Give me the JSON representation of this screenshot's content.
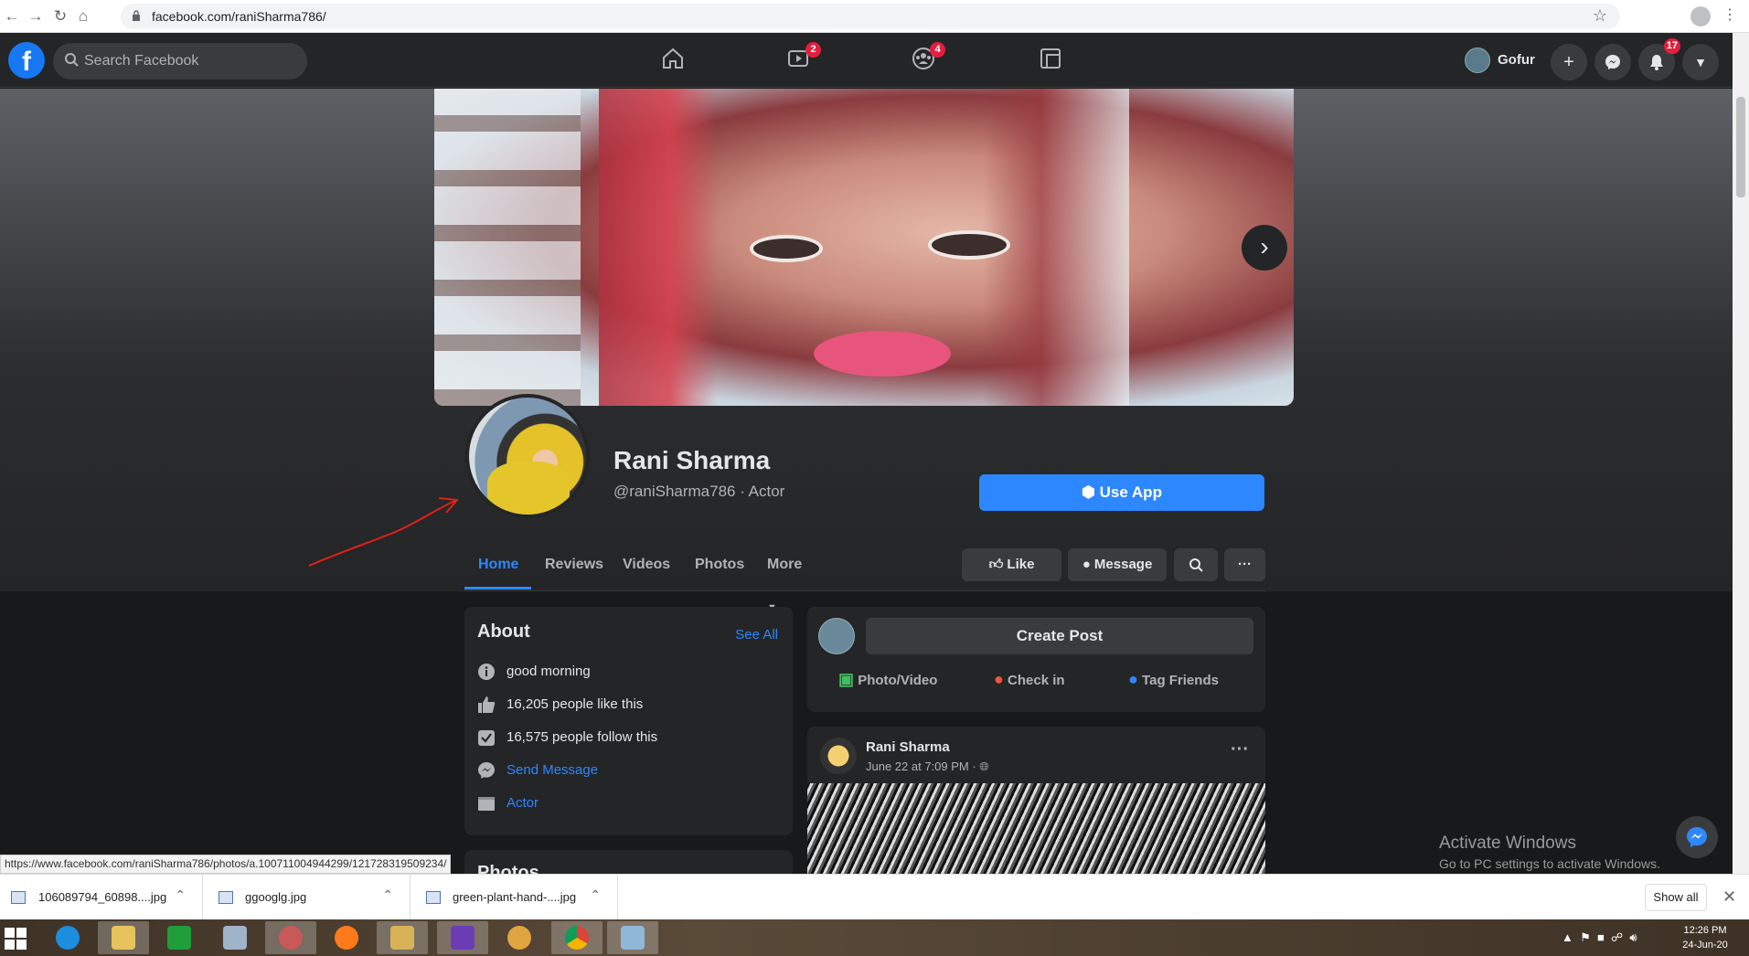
{
  "browser": {
    "url": "facebook.com/raniSharma786/",
    "status_url": "https://www.facebook.com/raniSharma786/photos/a.100711004944299/121728319509234/"
  },
  "topnav": {
    "logo": "f",
    "search_placeholder": "Search Facebook",
    "watch_badge": "2",
    "groups_badge": "4",
    "user_name": "Gofur",
    "notifications_badge": "17",
    "icons": [
      "home-icon",
      "watch-icon",
      "groups-icon",
      "gaming-icon",
      "plus-icon",
      "messenger-icon",
      "bell-icon",
      "caret-down-icon"
    ]
  },
  "profile": {
    "name": "Rani Sharma",
    "handle": "@raniSharma786 · Actor",
    "use_app": "Use App"
  },
  "tabs": [
    {
      "label": "Home"
    },
    {
      "label": "Reviews"
    },
    {
      "label": "Videos"
    },
    {
      "label": "Photos"
    },
    {
      "label": "More"
    }
  ],
  "actions": {
    "like": "Like",
    "message": "Message",
    "more": "···"
  },
  "about": {
    "title": "About",
    "see_all": "See All",
    "rows": [
      {
        "icon": "info-icon",
        "text": "good morning"
      },
      {
        "icon": "thumbs-up-icon",
        "text": "16,205 people like this"
      },
      {
        "icon": "follow-check-icon",
        "text": "16,575 people follow this"
      },
      {
        "icon": "messenger-icon",
        "text": "Send Message"
      },
      {
        "icon": "category-icon",
        "text": "Actor"
      }
    ],
    "next_card_title": "Photos"
  },
  "create_post": {
    "button": "Create Post",
    "photo_video": "Photo/Video",
    "check_in": "Check in",
    "tag_friends": "Tag Friends"
  },
  "post": {
    "author": "Rani Sharma",
    "date": "June 22 at 7:09 PM · "
  },
  "windows": {
    "activate_title": "Activate Windows",
    "activate_sub": "Go to PC settings to activate Windows.",
    "time": "12:26 PM",
    "date": "24-Jun-20"
  },
  "downloads": {
    "items": [
      {
        "name": "106089794_60898....jpg"
      },
      {
        "name": "ggooglg.jpg"
      },
      {
        "name": "green-plant-hand-....jpg"
      }
    ],
    "show_all": "Show all"
  },
  "colors": {
    "fb_blue": "#2d88ff",
    "bg_dark": "#18191a",
    "card_dark": "#242526",
    "badge_red": "#e41e3f"
  }
}
